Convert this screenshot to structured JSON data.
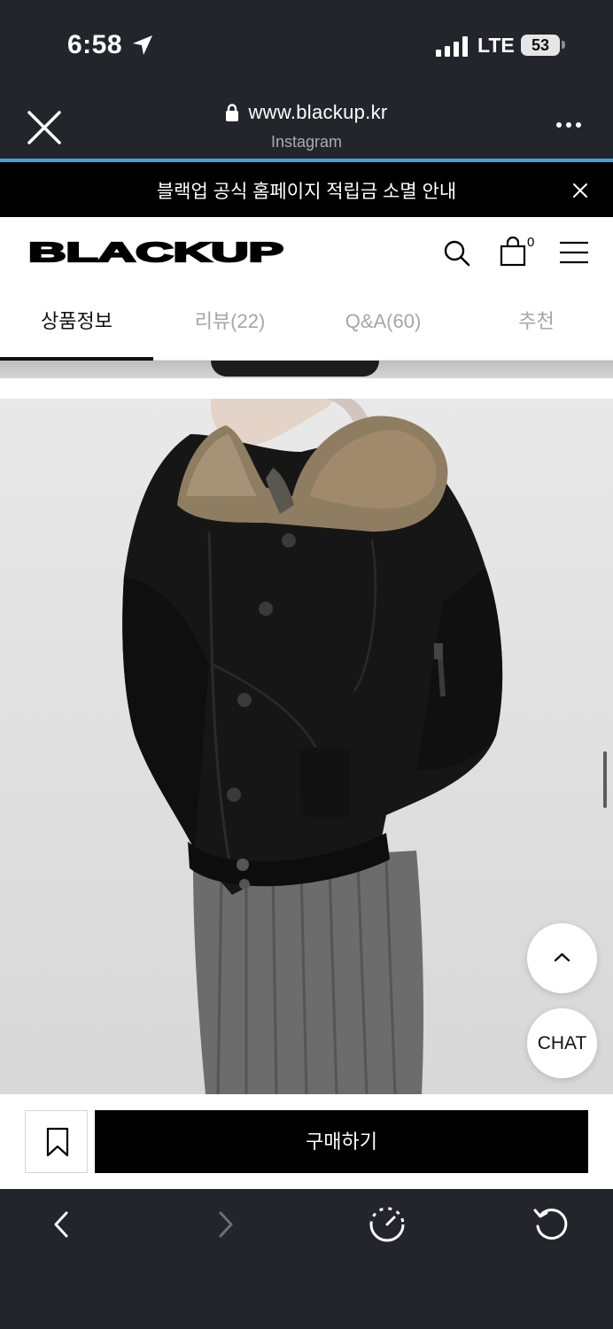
{
  "status_bar": {
    "time": "6:58",
    "network": "LTE",
    "battery": "53"
  },
  "browser": {
    "url": "www.blackup.kr",
    "source_app": "Instagram"
  },
  "notice_banner": {
    "text": "블랙업 공식 홈페이지 적립금 소멸 안내"
  },
  "header": {
    "logo_text": "BLACKUP",
    "cart_count": "0"
  },
  "tabs": [
    {
      "label": "상품정보",
      "active": true
    },
    {
      "label": "리뷰(22)",
      "active": false
    },
    {
      "label": "Q&A(60)",
      "active": false
    },
    {
      "label": "추천",
      "active": false
    }
  ],
  "floating": {
    "chat_label": "CHAT"
  },
  "purchase_bar": {
    "buy_label": "구매하기"
  },
  "colors": {
    "accent_progress": "#3ba4e0",
    "browser_chrome": "#22252c",
    "buy_button": "#000000"
  }
}
